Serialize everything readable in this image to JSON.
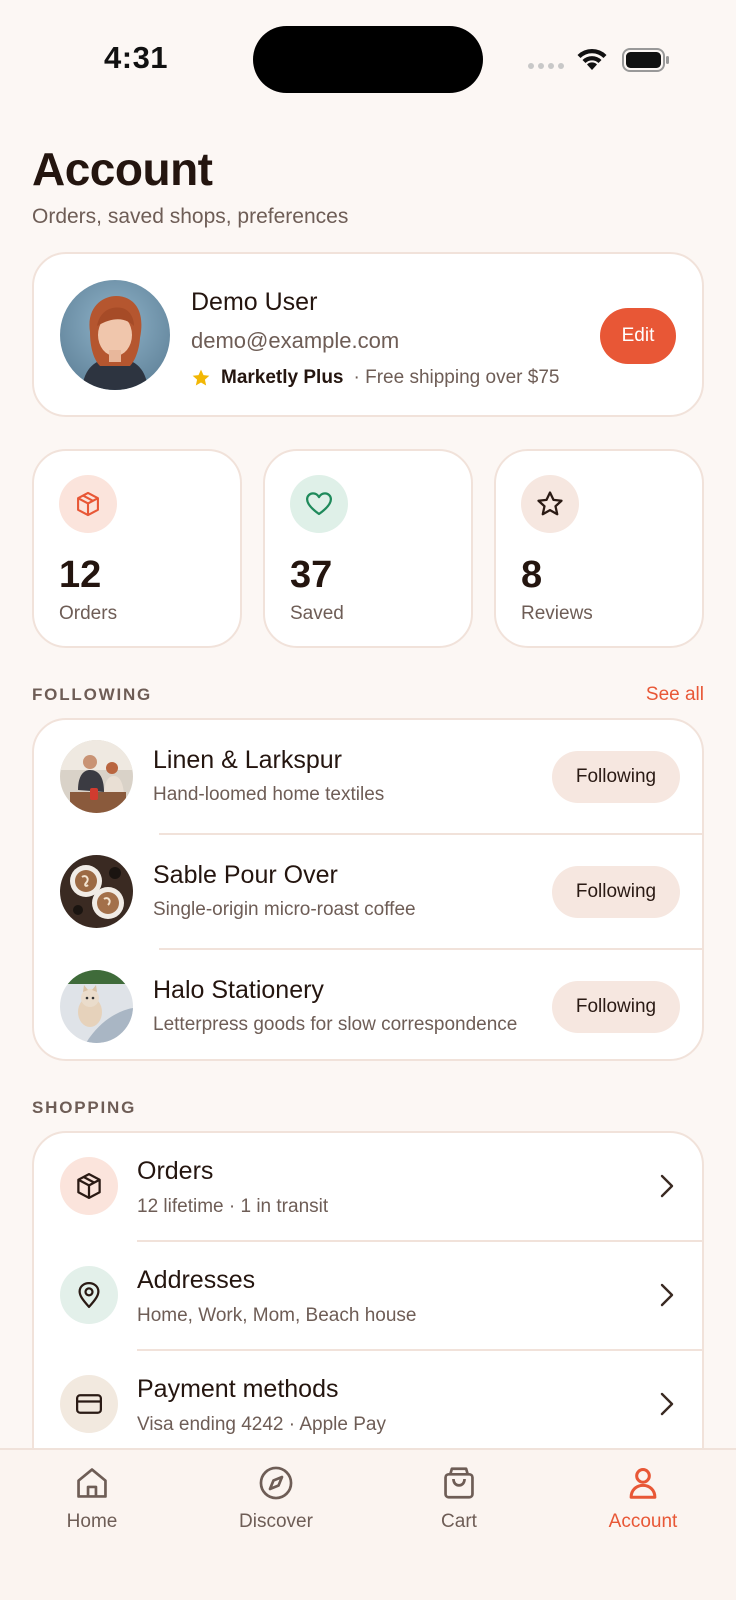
{
  "status_bar": {
    "time": "4:31"
  },
  "header": {
    "title": "Account",
    "subtitle": "Orders, saved shops, preferences"
  },
  "profile": {
    "name": "Demo User",
    "email": "demo@example.com",
    "membership": "Marketly Plus",
    "membership_note": "· Free shipping over $75",
    "edit_label": "Edit"
  },
  "stats": [
    {
      "value": "12",
      "label": "Orders",
      "icon": "box-icon",
      "icon_bg": "#fbe4dc",
      "icon_color": "#e85736"
    },
    {
      "value": "37",
      "label": "Saved",
      "icon": "heart-icon",
      "icon_bg": "#dff0e8",
      "icon_color": "#1f8a5b"
    },
    {
      "value": "8",
      "label": "Reviews",
      "icon": "star-outline-icon",
      "icon_bg": "#f6e7e0",
      "icon_color": "#2a1a14"
    }
  ],
  "following": {
    "title": "FOLLOWING",
    "see_all": "See all",
    "shops": [
      {
        "name": "Linen & Larkspur",
        "desc": "Hand-loomed home textiles",
        "button": "Following"
      },
      {
        "name": "Sable Pour Over",
        "desc": "Single-origin micro-roast coffee",
        "button": "Following"
      },
      {
        "name": "Halo Stationery",
        "desc": "Letterpress goods for slow correspondence",
        "button": "Following"
      }
    ]
  },
  "shopping": {
    "title": "SHOPPING",
    "items": [
      {
        "title": "Orders",
        "subtitle": "12 lifetime · 1 in transit",
        "icon": "box-icon",
        "icon_bg": "#fbe4dc"
      },
      {
        "title": "Addresses",
        "subtitle": "Home, Work, Mom, Beach house",
        "icon": "location-pin-icon",
        "icon_bg": "#e3f0ea"
      },
      {
        "title": "Payment methods",
        "subtitle": "Visa ending 4242 · Apple Pay",
        "icon": "credit-card-icon",
        "icon_bg": "#f2e9df"
      }
    ]
  },
  "tabs": [
    {
      "label": "Home",
      "icon": "home-icon"
    },
    {
      "label": "Discover",
      "icon": "compass-icon"
    },
    {
      "label": "Cart",
      "icon": "shopping-bag-icon"
    },
    {
      "label": "Account",
      "icon": "user-icon",
      "active": true
    }
  ],
  "colors": {
    "accent": "#e85736",
    "background": "#fcf7f4",
    "card_border": "#f1e2da"
  }
}
